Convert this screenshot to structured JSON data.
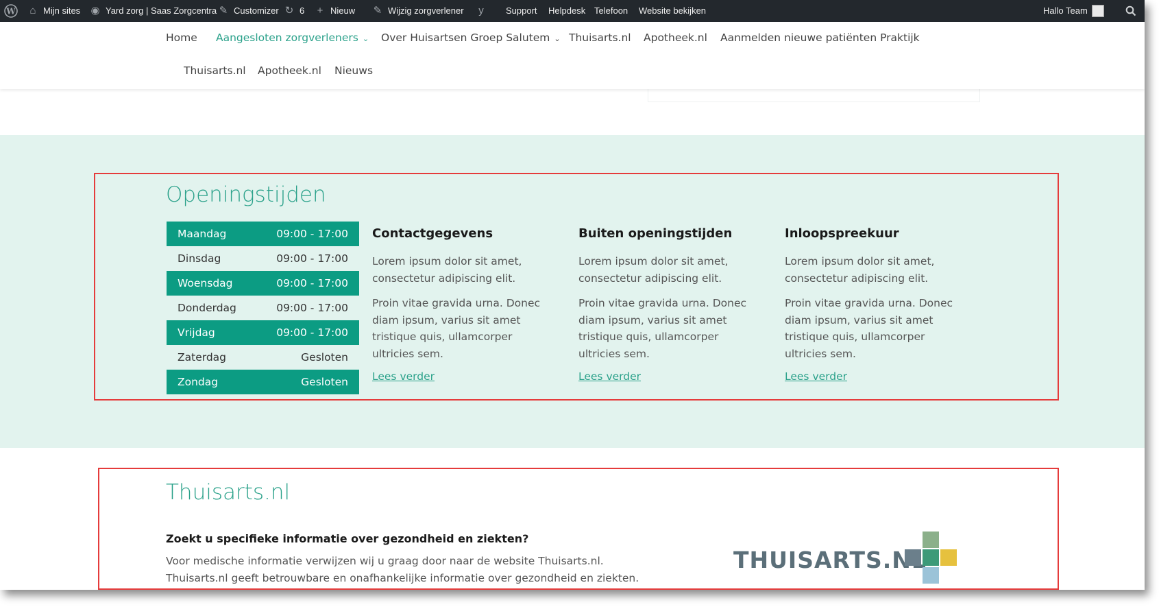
{
  "adminbar": {
    "wp_icon": "wordpress-icon",
    "items": [
      {
        "label": "Mijn sites",
        "icon": "sites-icon"
      },
      {
        "label": "Yard zorg | Saas Zorgcentra",
        "icon": "home-icon"
      },
      {
        "label": "Customizer",
        "icon": "brush-icon"
      },
      {
        "label": "6",
        "icon": "updates-icon"
      },
      {
        "label": "Nieuw",
        "icon": "plus-icon"
      },
      {
        "label": "Wijzig zorgverlener",
        "icon": "pencil-icon"
      },
      {
        "label": "",
        "icon": "yoast-icon"
      },
      {
        "label": "Support"
      },
      {
        "label": "Helpdesk"
      },
      {
        "label": "Telefoon"
      },
      {
        "label": "Website bekijken"
      }
    ],
    "greeting": "Hallo Team",
    "search_icon": "search-icon"
  },
  "nav": {
    "row1": [
      {
        "label": "Home"
      },
      {
        "label": "Aangesloten zorgverleners",
        "dropdown": true,
        "active": true
      },
      {
        "label": "Over Huisartsen Groep Salutem",
        "dropdown": true
      },
      {
        "label": "Thuisarts.nl"
      },
      {
        "label": "Apotheek.nl"
      },
      {
        "label": "Aanmelden nieuwe patiënten Praktijk"
      }
    ],
    "row2": [
      {
        "label": "Thuisarts.nl"
      },
      {
        "label": "Apotheek.nl"
      },
      {
        "label": "Nieuws"
      }
    ]
  },
  "hours": {
    "title": "Openingstijden",
    "rows": [
      {
        "day": "Maandag",
        "time": "09:00 - 17:00"
      },
      {
        "day": "Dinsdag",
        "time": "09:00 - 17:00"
      },
      {
        "day": "Woensdag",
        "time": "09:00 - 17:00"
      },
      {
        "day": "Donderdag",
        "time": "09:00 - 17:00"
      },
      {
        "day": "Vrijdag",
        "time": "09:00 - 17:00"
      },
      {
        "day": "Zaterdag",
        "time": "Gesloten"
      },
      {
        "day": "Zondag",
        "time": "Gesloten"
      }
    ]
  },
  "columns": [
    {
      "title": "Contactgegevens",
      "p1": "Lorem ipsum dolor sit amet, consectetur adipiscing elit.",
      "p2": "Proin vitae gravida urna. Donec diam ipsum, varius sit amet tristique quis, ullamcorper ultricies sem.",
      "link": "Lees verder"
    },
    {
      "title": "Buiten openingstijden",
      "p1": "Lorem ipsum dolor sit amet, consectetur adipiscing elit.",
      "p2": "Proin vitae gravida urna. Donec diam ipsum, varius sit amet tristique quis, ullamcorper ultricies sem.",
      "link": "Lees verder"
    },
    {
      "title": "Inloopspreekuur",
      "p1": "Lorem ipsum dolor sit amet, consectetur adipiscing elit.",
      "p2": "Proin vitae gravida urna. Donec diam ipsum, varius sit amet tristique quis, ullamcorper ultricies sem.",
      "link": "Lees verder"
    }
  ],
  "thuisarts": {
    "title": "Thuisarts.nl",
    "heading": "Zoekt u specifieke informatie over gezondheid en ziekten?",
    "text1": "Voor medische informatie verwijzen wij u graag door naar de website Thuisarts.nl.",
    "text2": "Thuisarts.nl geeft betrouwbare en onafhankelijke informatie over gezondheid en ziekten.",
    "logo_text": "THUISARTS.NL"
  },
  "colors": {
    "accent": "#2aa18a",
    "row_dark": "#0c9c83",
    "band": "#e2f3ee",
    "annotation": "#e53b3b",
    "adminbar": "#23282d"
  }
}
